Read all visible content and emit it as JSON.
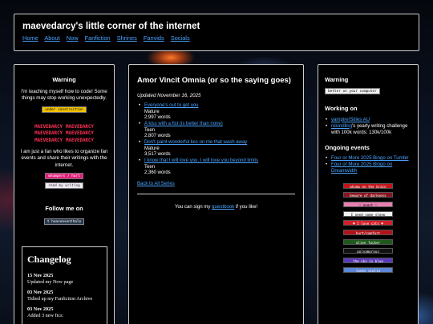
{
  "header": {
    "title": "maevedarcy's little corner of the internet",
    "nav": [
      "Home",
      "About",
      "Now",
      "Fanfiction",
      "Shrines",
      "Fanvids",
      "Socials"
    ]
  },
  "left": {
    "warning_heading": "Warning",
    "warning_text": "I'm teaching myself how to code! Some things may stop working unexpectedly.",
    "construction_button": "under construction",
    "blink_text": "MAEVEDARCY",
    "about_text": "I am just a fan who likes to organize fan events and share their writings with the internet.",
    "button_1": "whumpers / hurt",
    "button_2": "read my writing",
    "follow_heading": "Follow me on",
    "follow_button": "heavensenthalo",
    "changelog": {
      "heading": "Changelog",
      "entries": [
        {
          "date": "15 Nov 2025",
          "text": "Updated my Now page"
        },
        {
          "date": "03 Nov 2025",
          "text": "Tidied up my Fanfiction Archive"
        },
        {
          "date": "03 Nov 2025",
          "text": "Added 3 new fics:"
        }
      ]
    }
  },
  "main": {
    "title": "Amor Vincit Omnia (or so the saying goes)",
    "date": "Updated November 16, 2025",
    "fics": [
      {
        "title": "Everyone's out to get you",
        "rating": "Mature",
        "words": "2,997 words"
      },
      {
        "title": "A kiss with a fist (is better than none)",
        "rating": "Teen",
        "words": "2,807 words"
      },
      {
        "title": "Don't paint wonderful lies on me that wash away",
        "rating": "Mature",
        "words": "3,517 words"
      },
      {
        "title": "I know that I will love you, I will love you beyond limits",
        "rating": "Teen",
        "words": "2,360 words"
      }
    ],
    "back_link": "Back to All Series",
    "guestbook_before": "You can sign my ",
    "guestbook_link": "guestbook",
    "guestbook_after": " if you like!"
  },
  "right": {
    "warning_heading": "Warning",
    "browser_button": "better on your computer",
    "working_heading": "Working on",
    "working_items": [
      {
        "link": "vampire!Stiles AU",
        "rest": ""
      },
      {
        "link": "rekindling",
        "rest": "'s yearly writing challenge with 100k words: 130k/100k"
      }
    ],
    "ongoing_heading": "Ongoing events",
    "ongoing_items": [
      "Four or More 2025 Bingo on Tumblr",
      "Four or More 2025 Bingo on Dreamwidth"
    ],
    "stamps": [
      {
        "label": "whump on the brain",
        "bg": "#c0161c"
      },
      {
        "label": "beware of darkness",
        "bg": "#8a1420"
      },
      {
        "label": "♡ angst ♡",
        "bg": "#e87fb0"
      },
      {
        "label": "I need some sleep",
        "bg": "#f2f2f2"
      },
      {
        "label": "♥ I love cats ♥",
        "bg": "#d61e2a"
      },
      {
        "label": "hurt/comfort",
        "bg": "#b3121a"
      },
      {
        "label": "alien fucker",
        "bg": "#1f5a1c"
      },
      {
        "label": "polyamorous",
        "bg": "#111111"
      },
      {
        "label": "the sky is blue",
        "bg": "#5a3ab8"
      },
      {
        "label": "loves violin",
        "bg": "#5d86d6"
      }
    ]
  },
  "colors": {
    "link": "#4aa3ff",
    "panel_bg": "#000000",
    "panel_border": "#cfcfcf"
  }
}
